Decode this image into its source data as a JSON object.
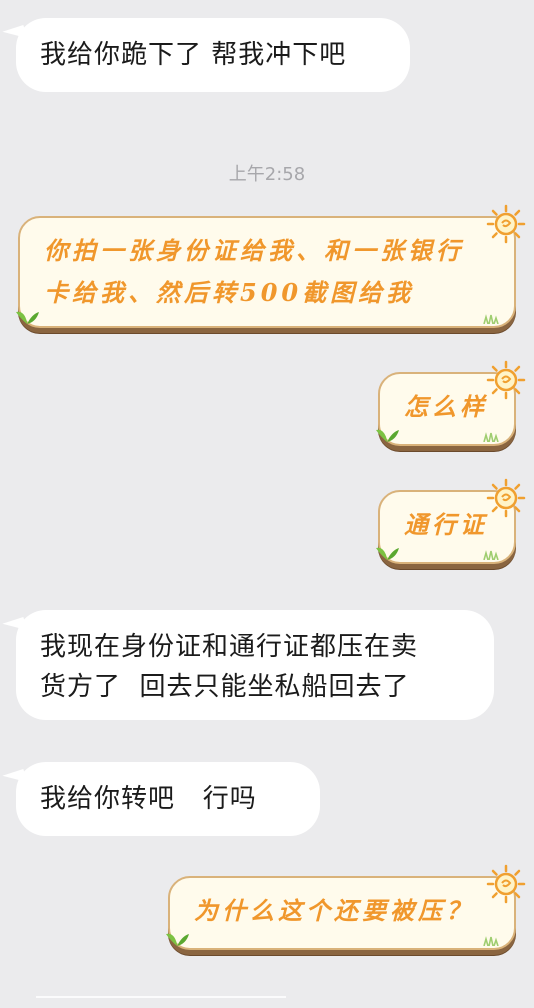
{
  "messages": {
    "m1": {
      "text": "我给你跪下了 帮我冲下吧"
    },
    "time": "上午2:58",
    "m2": {
      "text": "你拍一张身份证给我、和一张银行\n卡给我、然后转500截图给我"
    },
    "m3": {
      "text": "怎么样"
    },
    "m4": {
      "text": "通行证"
    },
    "m5": {
      "text": "我现在身份证和通行证都压在卖\n货方了  回去只能坐私船回去了"
    },
    "m6": {
      "text": "我给你转吧   行吗"
    },
    "m7": {
      "text": "为什么这个还要被压？"
    }
  },
  "theme": {
    "incoming_bubble": "#ffffff",
    "outgoing_bubble": "#fffbec",
    "outgoing_text": "#f0972c",
    "outgoing_border": "#d9b27a",
    "background": "#ebebed",
    "icons": [
      "sun-icon",
      "leaf-icon",
      "grass-icon"
    ]
  }
}
